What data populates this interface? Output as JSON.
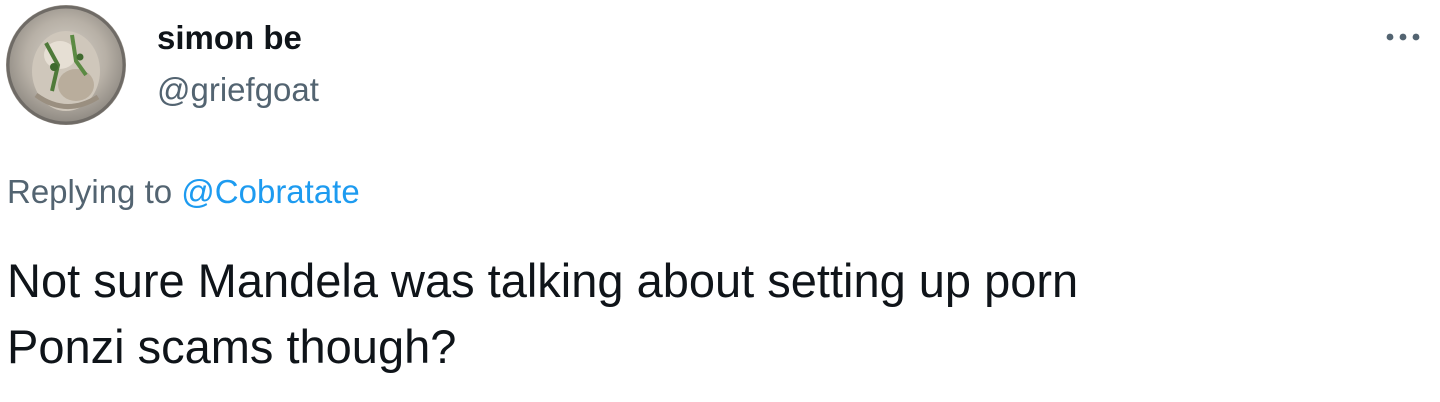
{
  "tweet": {
    "author": {
      "display_name": "simon be",
      "handle": "@griefgoat",
      "avatar_icon": "profile-photo"
    },
    "more_icon": "more-horizontal-icon",
    "reply": {
      "prefix": "Replying to",
      "mention": "@Cobratate"
    },
    "text": "Not sure Mandela was talking about setting up porn\nPonzi scams though?"
  },
  "colors": {
    "text_primary": "#0f1419",
    "text_secondary": "#536471",
    "link": "#1d9bf0",
    "background": "#ffffff"
  }
}
